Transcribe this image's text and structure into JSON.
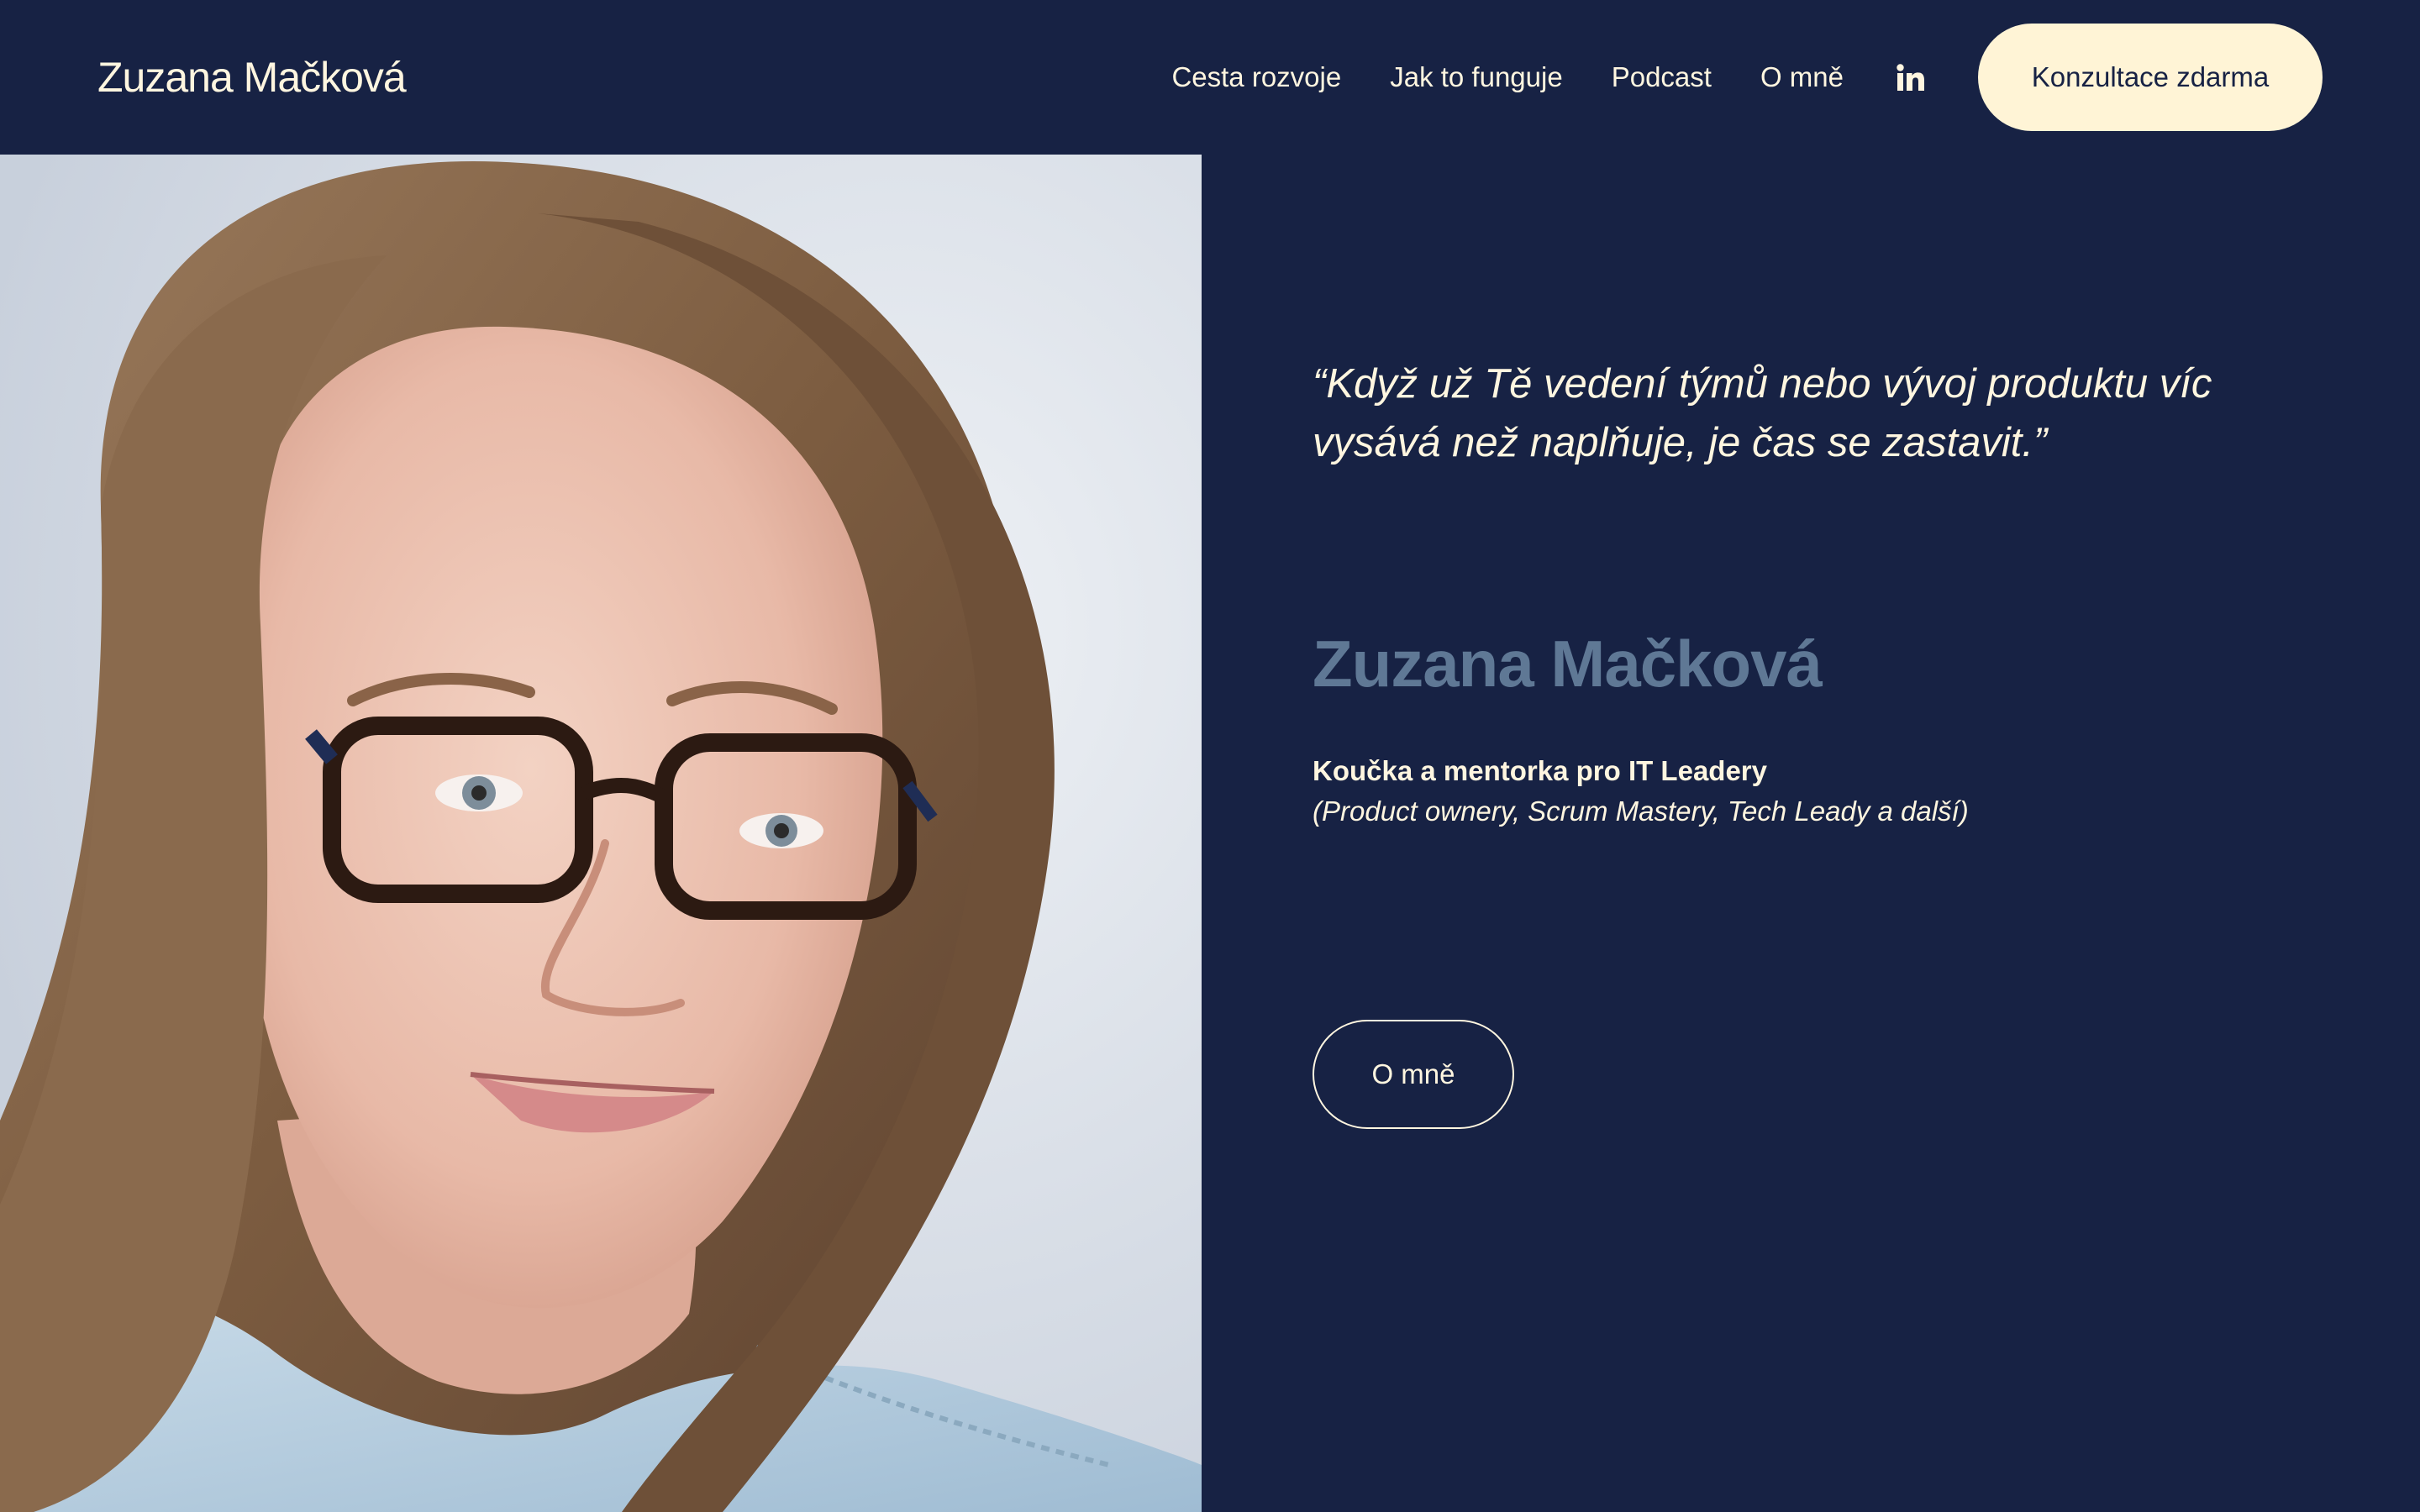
{
  "header": {
    "logo": "Zuzana Mačková",
    "nav": [
      {
        "label": "Cesta rozvoje"
      },
      {
        "label": "Jak to funguje"
      },
      {
        "label": "Podcast"
      },
      {
        "label": "O mně"
      }
    ],
    "linkedin_icon": "linkedin-icon",
    "cta_label": "Konzultace zdarma"
  },
  "hero": {
    "quote": "“Když už Tě vedení týmů nebo vývoj produktu víc vysává než naplňuje, je čas se zastavit.”",
    "name": "Zuzana Mačková",
    "role": "Koučka a mentorka pro IT Leadery",
    "role_sub": "(Product ownery, Scrum Mastery, Tech Leady a další)",
    "about_button": "O mně",
    "photo_icon": "portrait-photo"
  },
  "colors": {
    "background": "#172244",
    "text": "#fff6e0",
    "accent_button": "#fff4d6",
    "name": "#5f7895"
  }
}
